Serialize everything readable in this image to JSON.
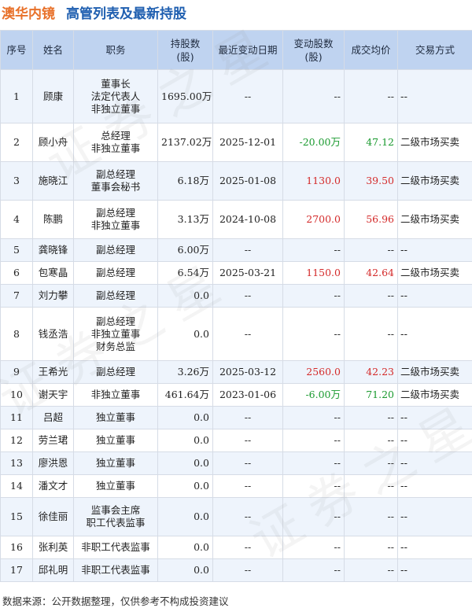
{
  "title": {
    "company": "澳华内镜",
    "text": "高管列表及最新持股"
  },
  "columns": [
    "序号",
    "姓名",
    "职务",
    "持股数\n(股)",
    "最近变动日期",
    "变动股数\n(股)",
    "成交均价",
    "交易方式"
  ],
  "rows": [
    {
      "no": "1",
      "name": "顾康",
      "positions": [
        "董事长",
        "法定代表人",
        "非独立董事"
      ],
      "shares": "1695.00万",
      "date": "--",
      "change": "--",
      "change_color": "",
      "price": "--",
      "price_color": "",
      "method": "--"
    },
    {
      "no": "2",
      "name": "顾小舟",
      "positions": [
        "总经理",
        "非独立董事"
      ],
      "shares": "2137.02万",
      "date": "2025-12-01",
      "change": "-20.00万",
      "change_color": "green",
      "price": "47.12",
      "price_color": "green",
      "method": "二级市场买卖"
    },
    {
      "no": "3",
      "name": "施晓江",
      "positions": [
        "副总经理",
        "董事会秘书"
      ],
      "shares": "6.18万",
      "date": "2025-01-08",
      "change": "1130.0",
      "change_color": "red",
      "price": "39.50",
      "price_color": "red",
      "method": "二级市场买卖"
    },
    {
      "no": "4",
      "name": "陈鹏",
      "positions": [
        "副总经理",
        "非独立董事"
      ],
      "shares": "3.13万",
      "date": "2024-10-08",
      "change": "2700.0",
      "change_color": "red",
      "price": "56.96",
      "price_color": "red",
      "method": "二级市场买卖"
    },
    {
      "no": "5",
      "name": "龚晓锋",
      "positions": [
        "副总经理"
      ],
      "shares": "6.00万",
      "date": "--",
      "change": "--",
      "change_color": "",
      "price": "--",
      "price_color": "",
      "method": "--"
    },
    {
      "no": "6",
      "name": "包寒晶",
      "positions": [
        "副总经理"
      ],
      "shares": "6.54万",
      "date": "2025-03-21",
      "change": "1150.0",
      "change_color": "red",
      "price": "42.64",
      "price_color": "red",
      "method": "二级市场买卖"
    },
    {
      "no": "7",
      "name": "刘力攀",
      "positions": [
        "副总经理"
      ],
      "shares": "0.0",
      "date": "--",
      "change": "--",
      "change_color": "",
      "price": "--",
      "price_color": "",
      "method": "--"
    },
    {
      "no": "8",
      "name": "钱丞浩",
      "positions": [
        "副总经理",
        "非独立董事",
        "财务总监"
      ],
      "shares": "0.0",
      "date": "--",
      "change": "--",
      "change_color": "",
      "price": "--",
      "price_color": "",
      "method": "--"
    },
    {
      "no": "9",
      "name": "王希光",
      "positions": [
        "副总经理"
      ],
      "shares": "3.26万",
      "date": "2025-03-12",
      "change": "2560.0",
      "change_color": "red",
      "price": "42.23",
      "price_color": "red",
      "method": "二级市场买卖"
    },
    {
      "no": "10",
      "name": "谢天宇",
      "positions": [
        "非独立董事"
      ],
      "shares": "461.64万",
      "date": "2023-01-06",
      "change": "-6.00万",
      "change_color": "green",
      "price": "71.20",
      "price_color": "green",
      "method": "二级市场买卖"
    },
    {
      "no": "11",
      "name": "吕超",
      "positions": [
        "独立董事"
      ],
      "shares": "0.0",
      "date": "--",
      "change": "--",
      "change_color": "",
      "price": "--",
      "price_color": "",
      "method": "--"
    },
    {
      "no": "12",
      "name": "劳兰珺",
      "positions": [
        "独立董事"
      ],
      "shares": "0.0",
      "date": "--",
      "change": "--",
      "change_color": "",
      "price": "--",
      "price_color": "",
      "method": "--"
    },
    {
      "no": "13",
      "name": "廖洪恩",
      "positions": [
        "独立董事"
      ],
      "shares": "0.0",
      "date": "--",
      "change": "--",
      "change_color": "",
      "price": "--",
      "price_color": "",
      "method": "--"
    },
    {
      "no": "14",
      "name": "潘文才",
      "positions": [
        "独立董事"
      ],
      "shares": "0.0",
      "date": "--",
      "change": "--",
      "change_color": "",
      "price": "--",
      "price_color": "",
      "method": "--"
    },
    {
      "no": "15",
      "name": "徐佳丽",
      "positions": [
        "监事会主席",
        "职工代表监事"
      ],
      "shares": "0.0",
      "date": "--",
      "change": "--",
      "change_color": "",
      "price": "--",
      "price_color": "",
      "method": "--"
    },
    {
      "no": "16",
      "name": "张利英",
      "positions": [
        "非职工代表监事"
      ],
      "shares": "0.0",
      "date": "--",
      "change": "--",
      "change_color": "",
      "price": "--",
      "price_color": "",
      "method": "--"
    },
    {
      "no": "17",
      "name": "邱礼明",
      "positions": [
        "非职工代表监事"
      ],
      "shares": "0.0",
      "date": "--",
      "change": "--",
      "change_color": "",
      "price": "--",
      "price_color": "",
      "method": "--"
    }
  ],
  "footer": "数据来源：公开数据整理，仅供参考不构成投资建议",
  "colors": {
    "header_bg": "#bfd3f0",
    "stripe_bg": "#eef4fc",
    "up": "#d42a2a",
    "down": "#1a9a2f",
    "company": "#e8712a",
    "title": "#1f5fb0"
  }
}
